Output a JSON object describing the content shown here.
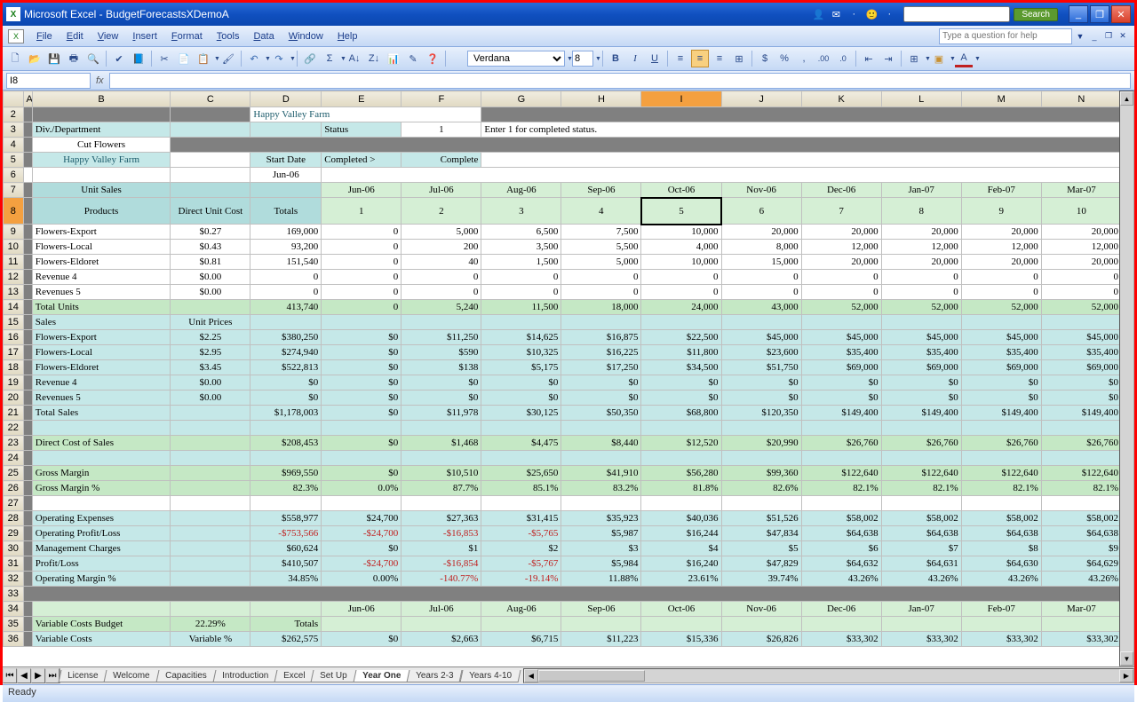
{
  "title": "Microsoft Excel - BudgetForecastsXDemoA",
  "menus": [
    "File",
    "Edit",
    "View",
    "Insert",
    "Format",
    "Tools",
    "Data",
    "Window",
    "Help"
  ],
  "help_placeholder": "Type a question for help",
  "search_btn": "Search",
  "font": "Verdana",
  "fontsize": "8",
  "namebox": "I8",
  "status": "Ready",
  "tabs": [
    "License",
    "Welcome",
    "Capacities",
    "Introduction",
    "Excel",
    "Set Up",
    "Year One",
    "Years 2-3",
    "Years 4-10"
  ],
  "active_tab": 6,
  "cols": [
    "A",
    "B",
    "C",
    "D",
    "E",
    "F",
    "G",
    "H",
    "I",
    "J",
    "K",
    "L",
    "M",
    "N"
  ],
  "rows_start": 2,
  "rows_end": 36,
  "sheet": {
    "d2": "Happy Valley Farm",
    "b3": "Div./Department",
    "e3": "Status",
    "f3": "1",
    "g3": "Enter 1 for completed status.",
    "b4": "Cut Flowers",
    "b5": "Happy Valley Farm",
    "d5": "Start Date",
    "e5": "Completed >",
    "f5": "Complete",
    "d6": "Jun-06",
    "b7": "Unit Sales",
    "months": [
      "Jun-06",
      "Jul-06",
      "Aug-06",
      "Sep-06",
      "Oct-06",
      "Nov-06",
      "Dec-06",
      "Jan-07",
      "Feb-07",
      "Mar-07"
    ],
    "b8": "Products",
    "c8": "Direct Unit Cost",
    "d8": "Totals",
    "nums8": [
      "1",
      "2",
      "3",
      "4",
      "5",
      "6",
      "7",
      "8",
      "9",
      "10"
    ],
    "r9": {
      "b": "Flowers-Export",
      "c": "$0.27",
      "d": "169,000",
      "e": "0",
      "f": "5,000",
      "g": "6,500",
      "h": "7,500",
      "i": "10,000",
      "j": "20,000",
      "k": "20,000",
      "l": "20,000",
      "m": "20,000",
      "n": "20,000"
    },
    "r10": {
      "b": "Flowers-Local",
      "c": "$0.43",
      "d": "93,200",
      "e": "0",
      "f": "200",
      "g": "3,500",
      "h": "5,500",
      "i": "4,000",
      "j": "8,000",
      "k": "12,000",
      "l": "12,000",
      "m": "12,000",
      "n": "12,000"
    },
    "r11": {
      "b": "Flowers-Eldoret",
      "c": "$0.81",
      "d": "151,540",
      "e": "0",
      "f": "40",
      "g": "1,500",
      "h": "5,000",
      "i": "10,000",
      "j": "15,000",
      "k": "20,000",
      "l": "20,000",
      "m": "20,000",
      "n": "20,000"
    },
    "r12": {
      "b": "Revenue 4",
      "c": "$0.00",
      "d": "0",
      "e": "0",
      "f": "0",
      "g": "0",
      "h": "0",
      "i": "0",
      "j": "0",
      "k": "0",
      "l": "0",
      "m": "0",
      "n": "0"
    },
    "r13": {
      "b": "Revenues 5",
      "c": "$0.00",
      "d": "0",
      "e": "0",
      "f": "0",
      "g": "0",
      "h": "0",
      "i": "0",
      "j": "0",
      "k": "0",
      "l": "0",
      "m": "0",
      "n": "0"
    },
    "r14": {
      "b": "Total Units",
      "d": "413,740",
      "e": "0",
      "f": "5,240",
      "g": "11,500",
      "h": "18,000",
      "i": "24,000",
      "j": "43,000",
      "k": "52,000",
      "l": "52,000",
      "m": "52,000",
      "n": "52,000"
    },
    "r15": {
      "b": "Sales",
      "c": "Unit Prices"
    },
    "r16": {
      "b": "Flowers-Export",
      "c": "$2.25",
      "d": "$380,250",
      "e": "$0",
      "f": "$11,250",
      "g": "$14,625",
      "h": "$16,875",
      "i": "$22,500",
      "j": "$45,000",
      "k": "$45,000",
      "l": "$45,000",
      "m": "$45,000",
      "n": "$45,000"
    },
    "r17": {
      "b": "Flowers-Local",
      "c": "$2.95",
      "d": "$274,940",
      "e": "$0",
      "f": "$590",
      "g": "$10,325",
      "h": "$16,225",
      "i": "$11,800",
      "j": "$23,600",
      "k": "$35,400",
      "l": "$35,400",
      "m": "$35,400",
      "n": "$35,400"
    },
    "r18": {
      "b": "Flowers-Eldoret",
      "c": "$3.45",
      "d": "$522,813",
      "e": "$0",
      "f": "$138",
      "g": "$5,175",
      "h": "$17,250",
      "i": "$34,500",
      "j": "$51,750",
      "k": "$69,000",
      "l": "$69,000",
      "m": "$69,000",
      "n": "$69,000"
    },
    "r19": {
      "b": "Revenue 4",
      "c": "$0.00",
      "d": "$0",
      "e": "$0",
      "f": "$0",
      "g": "$0",
      "h": "$0",
      "i": "$0",
      "j": "$0",
      "k": "$0",
      "l": "$0",
      "m": "$0",
      "n": "$0"
    },
    "r20": {
      "b": "Revenues 5",
      "c": "$0.00",
      "d": "$0",
      "e": "$0",
      "f": "$0",
      "g": "$0",
      "h": "$0",
      "i": "$0",
      "j": "$0",
      "k": "$0",
      "l": "$0",
      "m": "$0",
      "n": "$0"
    },
    "r21": {
      "b": "Total Sales",
      "d": "$1,178,003",
      "e": "$0",
      "f": "$11,978",
      "g": "$30,125",
      "h": "$50,350",
      "i": "$68,800",
      "j": "$120,350",
      "k": "$149,400",
      "l": "$149,400",
      "m": "$149,400",
      "n": "$149,400"
    },
    "r23": {
      "b": "Direct Cost of Sales",
      "d": "$208,453",
      "e": "$0",
      "f": "$1,468",
      "g": "$4,475",
      "h": "$8,440",
      "i": "$12,520",
      "j": "$20,990",
      "k": "$26,760",
      "l": "$26,760",
      "m": "$26,760",
      "n": "$26,760"
    },
    "r25": {
      "b": "Gross Margin",
      "d": "$969,550",
      "e": "$0",
      "f": "$10,510",
      "g": "$25,650",
      "h": "$41,910",
      "i": "$56,280",
      "j": "$99,360",
      "k": "$122,640",
      "l": "$122,640",
      "m": "$122,640",
      "n": "$122,640"
    },
    "r26": {
      "b": "Gross Margin %",
      "d": "82.3%",
      "e": "0.0%",
      "f": "87.7%",
      "g": "85.1%",
      "h": "83.2%",
      "i": "81.8%",
      "j": "82.6%",
      "k": "82.1%",
      "l": "82.1%",
      "m": "82.1%",
      "n": "82.1%"
    },
    "r28": {
      "b": "Operating Expenses",
      "d": "$558,977",
      "e": "$24,700",
      "f": "$27,363",
      "g": "$31,415",
      "h": "$35,923",
      "i": "$40,036",
      "j": "$51,526",
      "k": "$58,002",
      "l": "$58,002",
      "m": "$58,002",
      "n": "$58,002"
    },
    "r29": {
      "b": "Operating Profit/Loss",
      "d": "-$753,566",
      "e": "-$24,700",
      "f": "-$16,853",
      "g": "-$5,765",
      "h": "$5,987",
      "i": "$16,244",
      "j": "$47,834",
      "k": "$64,638",
      "l": "$64,638",
      "m": "$64,638",
      "n": "$64,638"
    },
    "r30": {
      "b": "Management Charges",
      "d": "$60,624",
      "e": "$0",
      "f": "$1",
      "g": "$2",
      "h": "$3",
      "i": "$4",
      "j": "$5",
      "k": "$6",
      "l": "$7",
      "m": "$8",
      "n": "$9"
    },
    "r31": {
      "b": "Profit/Loss",
      "d": "$410,507",
      "e": "-$24,700",
      "f": "-$16,854",
      "g": "-$5,767",
      "h": "$5,984",
      "i": "$16,240",
      "j": "$47,829",
      "k": "$64,632",
      "l": "$64,631",
      "m": "$64,630",
      "n": "$64,629"
    },
    "r32": {
      "b": "Operating Margin %",
      "d": "34.85%",
      "e": "0.00%",
      "f": "-140.77%",
      "g": "-19.14%",
      "h": "11.88%",
      "i": "23.61%",
      "j": "39.74%",
      "k": "43.26%",
      "l": "43.26%",
      "m": "43.26%",
      "n": "43.26%"
    },
    "r35": {
      "b": "Variable Costs Budget",
      "c": "22.29%",
      "d": "Totals"
    },
    "r36": {
      "b": "Variable Costs",
      "c": "Variable %",
      "d": "$262,575",
      "e": "$0",
      "f": "$2,663",
      "g": "$6,715",
      "h": "$11,223",
      "i": "$15,336",
      "j": "$26,826",
      "k": "$33,302",
      "l": "$33,302",
      "m": "$33,302",
      "n": "$33,302"
    }
  }
}
